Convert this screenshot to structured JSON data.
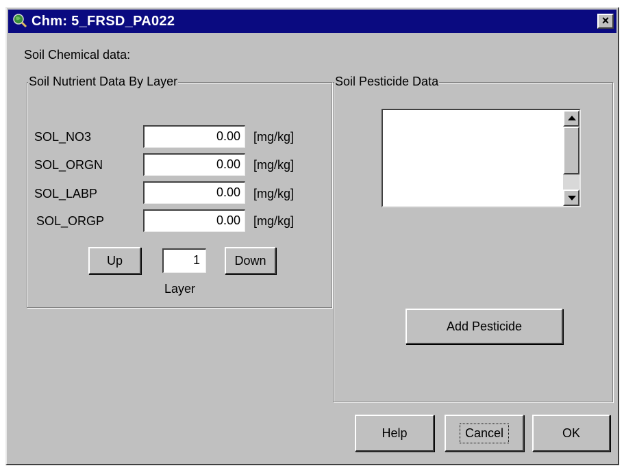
{
  "window": {
    "title": "Chm: 5_FRSD_PA022",
    "close_label": "×",
    "icon": "globe-magnifier-icon"
  },
  "heading": "Soil Chemical data:",
  "nutrient_group": {
    "legend": "Soil  Nutrient Data By Layer",
    "rows": [
      {
        "label": "SOL_NO3",
        "value": "0.00",
        "unit": "[mg/kg]"
      },
      {
        "label": "SOL_ORGN",
        "value": "0.00",
        "unit": "[mg/kg]"
      },
      {
        "label": "SOL_LABP",
        "value": "0.00",
        "unit": "[mg/kg]"
      },
      {
        "label": "SOL_ORGP",
        "value": "0.00",
        "unit": "[mg/kg]"
      }
    ],
    "up_label": "Up",
    "down_label": "Down",
    "layer_value": "1",
    "layer_label": "Layer"
  },
  "pesticide_group": {
    "legend": "Soil Pesticide Data",
    "items": [],
    "add_label": "Add Pesticide"
  },
  "buttons": {
    "help": "Help",
    "cancel": "Cancel",
    "ok": "OK"
  },
  "colors": {
    "titlebar": "#0a0a80",
    "face": "#c0c0c0"
  }
}
